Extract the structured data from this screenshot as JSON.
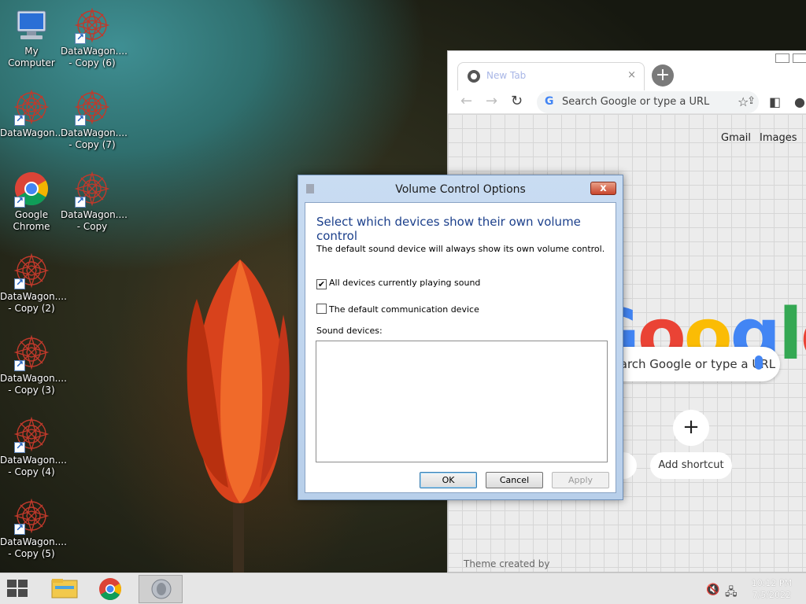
{
  "desktop_icons": [
    {
      "label": "My Computer",
      "icon": "computer-icon"
    },
    {
      "label": "DataWagon.... - Copy (6)",
      "icon": "datawagon-icon"
    },
    {
      "label": "DataWagon....",
      "icon": "datawagon-icon"
    },
    {
      "label": "DataWagon.... - Copy (7)",
      "icon": "datawagon-icon"
    },
    {
      "label": "Google Chrome",
      "icon": "chrome-icon"
    },
    {
      "label": "DataWagon.... - Copy",
      "icon": "datawagon-icon"
    },
    {
      "label": "DataWagon.... - Copy (2)",
      "icon": "datawagon-icon"
    },
    {
      "label": "DataWagon.... - Copy (3)",
      "icon": "datawagon-icon"
    },
    {
      "label": "DataWagon.... - Copy (4)",
      "icon": "datawagon-icon"
    },
    {
      "label": "DataWagon.... - Copy (5)",
      "icon": "datawagon-icon"
    }
  ],
  "browser": {
    "tab_title": "New Tab",
    "tab_close": "×",
    "new_tab": "+",
    "omnibox_placeholder": "Search Google or type a URL",
    "links": {
      "gmail": "Gmail",
      "images": "Images"
    },
    "logo_text": "Google",
    "search_placeholder": "Search Google or type a URL",
    "add_shortcut_icon": "+",
    "add_shortcut_label": "Add shortcut",
    "shortcut_partial_label": "s",
    "theme_credit": "Theme created by"
  },
  "dialog": {
    "title": "Volume Control Options",
    "close": "x",
    "heading": "Select which devices show their own volume control",
    "description": "The default sound device will always show its own volume control.",
    "options": [
      {
        "label": "All devices currently playing sound",
        "checked": true
      },
      {
        "label": "The default communication device",
        "checked": false
      }
    ],
    "devices_label": "Sound devices:",
    "buttons": {
      "ok": "OK",
      "cancel": "Cancel",
      "apply": "Apply"
    }
  },
  "taskbar": {
    "time": "10:12 PM",
    "date": "7/5/2022",
    "pinned": [
      "file-explorer-icon",
      "chrome-icon",
      "speaker-icon"
    ]
  },
  "colors": {
    "dialog_heading": "#1b3f8b",
    "google_blue": "#4285f4",
    "google_red": "#ea4335",
    "google_yellow": "#fbbc05",
    "google_green": "#34a853"
  }
}
